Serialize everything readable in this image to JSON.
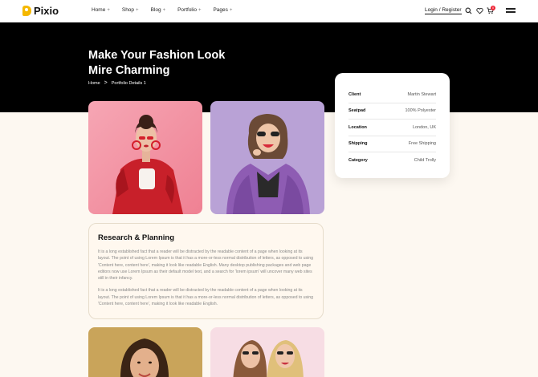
{
  "brand": {
    "name": "Pixio"
  },
  "nav": {
    "items": [
      {
        "label": "Home"
      },
      {
        "label": "Shop"
      },
      {
        "label": "Blog"
      },
      {
        "label": "Portfolio"
      },
      {
        "label": "Pages"
      }
    ],
    "plus": "+",
    "login": "Login / Register",
    "cart_count": "0"
  },
  "hero": {
    "title": "Make Your Fashion Look Mire Charming",
    "breadcrumb": {
      "home": "Home",
      "separator": ">",
      "current": "Portfolio Details 1"
    }
  },
  "details": [
    {
      "label": "Client",
      "value": "Martin Stewart"
    },
    {
      "label": "Seatpad",
      "value": "100% Polyester"
    },
    {
      "label": "Location",
      "value": "London, UK"
    },
    {
      "label": "Shipping",
      "value": "Free Shipping"
    },
    {
      "label": "Category",
      "value": "Child Trolly"
    }
  ],
  "research": {
    "title": "Research & Planning",
    "paragraph1": "It is a long established fact that a reader will be distracted by the readable content of a page when looking at its layout. The point of using Lorem Ipsum is that it has a more-or-less normal distribution of letters, as opposed to using 'Content here, content here', making it look like readable English. Many desktop publishing packages and web page editors now use Lorem Ipsum as their default model text, and a search for 'lorem ipsum' will uncover many web sites still in their infancy.",
    "paragraph2": "It is a long established fact that a reader will be distracted by the readable content of a page when looking at its layout. The point of using Lorem Ipsum is that it has a more-or-less normal distribution of letters, as opposed to using 'Content here, content here', making it look like readable English."
  },
  "colors": {
    "accent": "#f5b800",
    "hero_bg": "#000000",
    "page_bg": "#fdf8f1",
    "badge": "#ee2233"
  }
}
